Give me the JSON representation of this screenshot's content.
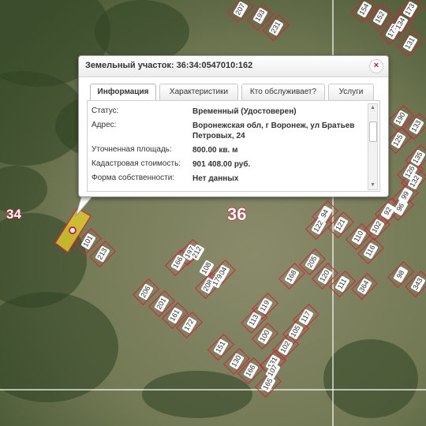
{
  "popup": {
    "title": "Земельный участок: 36:34:0547010:162",
    "close_icon": "×",
    "tabs": [
      {
        "label": "Информация",
        "active": true
      },
      {
        "label": "Характеристики",
        "active": false
      },
      {
        "label": "Кто обслуживает?",
        "active": false
      },
      {
        "label": "Услуги",
        "active": false
      }
    ],
    "rows": [
      {
        "label": "Статус:",
        "value": "Временный (Удостоверен)"
      },
      {
        "label": "Адрес:",
        "value": "Воронежская обл, г Воронеж, ул Братьев Петровых, 24"
      },
      {
        "label": "Уточненная площадь:",
        "value": "800.00 кв. м"
      },
      {
        "label": "Кадастровая стоимость:",
        "value": "901 408.00 руб."
      },
      {
        "label": "Форма собственности:",
        "value": "Нет данных"
      }
    ]
  },
  "map": {
    "zone_labels": [
      "34",
      "36"
    ],
    "parcel_numbers": [
      "207",
      "193",
      "231",
      "154",
      "152",
      "177",
      "173",
      "134",
      "131",
      "190",
      "133",
      "125",
      "135",
      "126",
      "132",
      "99",
      "96",
      "92",
      "94",
      "121",
      "122",
      "110",
      "102",
      "116",
      "98",
      "343",
      "364",
      "101",
      "213",
      "197",
      "166",
      "204",
      "208",
      "206",
      "201",
      "161",
      "172",
      "168",
      "205",
      "120",
      "111",
      "119",
      "113",
      "105",
      "102",
      "100",
      "117",
      "131",
      "151",
      "130",
      "166",
      "107",
      "165",
      "212",
      "108",
      "179"
    ],
    "colors": {
      "parcel_line": "#d3253b",
      "selected_fill": "#e8d62a",
      "grid_line": "#ffffff"
    }
  }
}
